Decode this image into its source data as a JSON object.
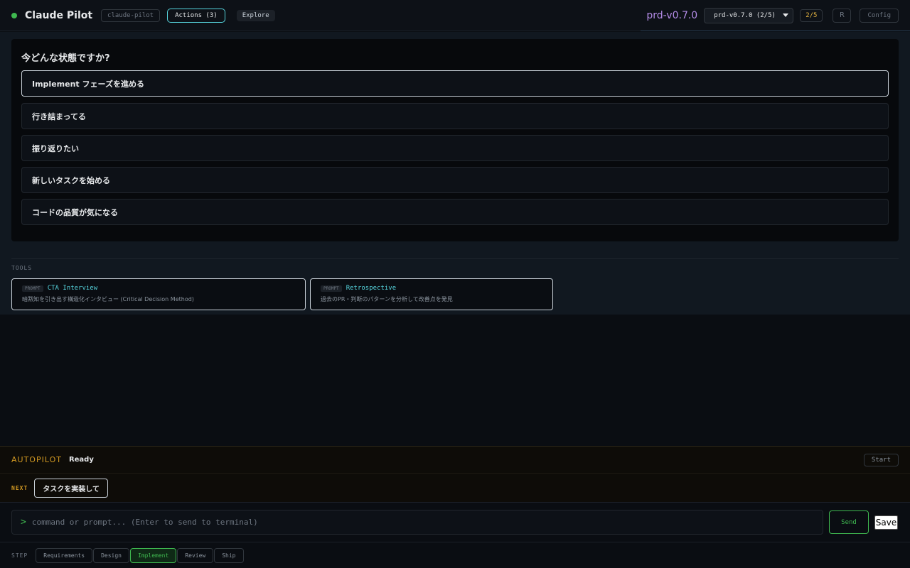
{
  "header": {
    "app_title": "Claude Pilot",
    "project": "claude-pilot",
    "actions_tab": "Actions (3)",
    "explore_tab": "Explore",
    "version_label": "prd-v0.7.0",
    "version_select": "prd-v0.7.0 (2/5)",
    "progress": "2/5",
    "r_button": "R",
    "config_button": "Config",
    "status_color": "#3fb950",
    "accent_color": "#56d4dd"
  },
  "question": {
    "title": "今どんな状態ですか?",
    "options": [
      {
        "label": "Implement フェーズを進める",
        "selected": true
      },
      {
        "label": "行き詰まってる",
        "selected": false
      },
      {
        "label": "振り返りたい",
        "selected": false
      },
      {
        "label": "新しいタスクを始める",
        "selected": false
      },
      {
        "label": "コードの品質が気になる",
        "selected": false
      }
    ]
  },
  "tools": {
    "label": "TOOLS",
    "items": [
      {
        "tag": "PROMPT",
        "name": "CTA Interview",
        "description": "暗黙知を引き出す構造化インタビュー (Critical Decision Method)"
      },
      {
        "tag": "PROMPT",
        "name": "Retrospective",
        "description": "過去のPR・判断のパターンを分析して改善点を発見"
      }
    ]
  },
  "autopilot": {
    "label": "AUTOPILOT",
    "status": "Ready",
    "start_button": "Start"
  },
  "next": {
    "label": "NEXT",
    "suggestion": "タスクを実装して"
  },
  "command": {
    "prompt_symbol": ">",
    "placeholder": "command or prompt... (Enter to send to terminal)",
    "value": "",
    "send_button": "Send",
    "save_button": "Save"
  },
  "steps": {
    "label": "STEP",
    "items": [
      "Requirements",
      "Design",
      "Implement",
      "Review",
      "Ship"
    ],
    "active": "Implement"
  }
}
